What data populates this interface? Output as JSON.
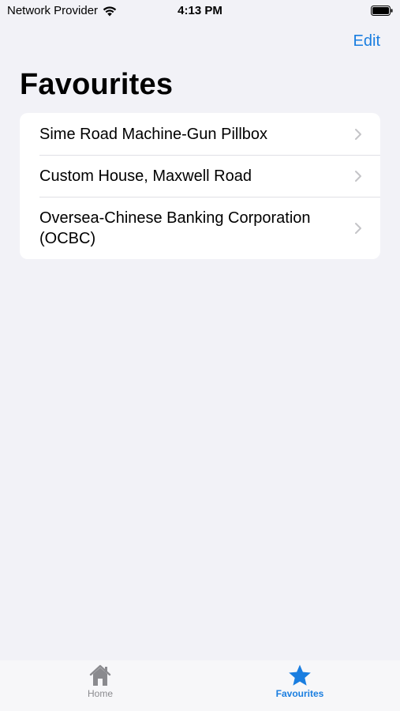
{
  "status_bar": {
    "carrier": "Network Provider",
    "time": "4:13 PM"
  },
  "nav": {
    "edit_label": "Edit",
    "title": "Favourites"
  },
  "favourites": {
    "items": [
      {
        "label": "Sime Road Machine-Gun Pillbox"
      },
      {
        "label": "Custom House, Maxwell Road"
      },
      {
        "label": "Oversea-Chinese Banking Corporation (OCBC)"
      }
    ]
  },
  "tab_bar": {
    "tabs": [
      {
        "label": "Home",
        "icon": "house-icon",
        "selected": false
      },
      {
        "label": "Favourites",
        "icon": "star-icon",
        "selected": true
      }
    ]
  },
  "colors": {
    "accent": "#1a7ee0",
    "background": "#f2f2f7",
    "inactive": "#8a8a8e"
  }
}
